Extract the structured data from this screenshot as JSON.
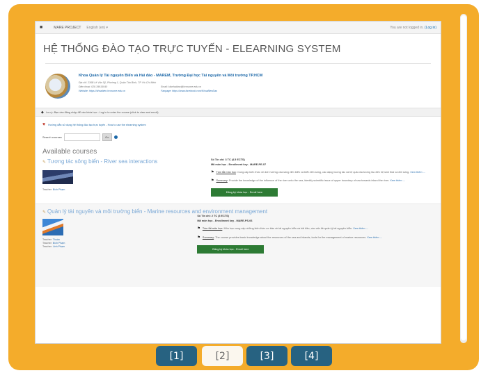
{
  "navbar": {
    "brand": "MARE PROJECT",
    "language": "English (en) ▾",
    "login_prefix": "You are not logged in.",
    "login_link": "(Log in)"
  },
  "site_title": "HỆ THỐNG ĐÀO TẠO TRỰC TUYẾN - ELEARNING SYSTEM",
  "faculty": {
    "name": "Khoa Quản lý Tài nguyên Biển và Hải đảo - MAREM, Trường Đại học Tài nguyên và Môi trường TP.HCM",
    "address": "Địa chỉ: 236B Lê Văn Sỹ, Phường 1, Quận Tân Bình, TP. Hồ Chí Minh",
    "phone": "Điện thoại: 028.39915040",
    "email": "Email: ktbnhaidao@hcmunre.edu.vn",
    "website": "Website: https://khoabien.hcmunre.edu.vn",
    "fanpage": "Fanpage: https://www.facebook.com/KhoaBienDao"
  },
  "notice": "Lưu ý: Bạn cần đăng nhập để vào khóa học - Log in to enter the course (click to view and enroll)",
  "guide_link": "Hướng dẫn sử dụng hệ thống đào tạo trực tuyến - How to use the elearning system",
  "search": {
    "label": "Search courses",
    "button": "Go"
  },
  "available_heading": "Available courses",
  "courses": [
    {
      "title": "Tương tác sông biển - River sea interactions",
      "teachers": [
        {
          "role": "Teacher:",
          "name": "Bích Phạm"
        }
      ],
      "credits": "Số Tín chỉ: 3 TC (4.5 ECTS)",
      "enrol_key": "Mã môn học - Enrollment key - MARE-PE-07",
      "desc_vi_label": "Tóm tắt môn học",
      "desc_vi": "Cung cấp kiến thức về ảnh hưởng của sông đến biển và biển đến sông, các dạng tương tác và hệ quả của tương tác đến hệ sinh thái và đời sống.",
      "desc_en_label": "Summary",
      "desc_en": "Provide the knowledge of the influence of the river onto the sea, identify scientific issue of upper boundary of sea towards inland the river.",
      "more": "Xem thêm ...",
      "enrol_button": "Đăng ký khóa học - Enroll here"
    },
    {
      "title": "Quản lý tài nguyên và môi trường biển - Marine resources and environment management",
      "teachers": [
        {
          "role": "Teacher:",
          "name": "Thuần"
        },
        {
          "role": "Teacher:",
          "name": "Bích Phạm"
        },
        {
          "role": "Teacher:",
          "name": "Linh Phạm"
        }
      ],
      "credits": "Số Tín chỉ: 2 TC (3 ECTS)",
      "enrol_key": "Mã môn học - Enrollment key - MARE-PS-06",
      "desc_vi_label": "Tóm tắt môn học",
      "desc_vi": "Môn học cung cấp những kiến thức cơ bản về tài nguyên biển và hải đảo, các vấn đề quản lý tài nguyên biển.",
      "desc_en_label": "Summary",
      "desc_en": "The course provides basic knowledge about the resources of the sea and islands, tools for the management of marine resources.",
      "more": "Xem thêm ...",
      "enrol_button": "Đăng ký khóa học - Enroll here"
    }
  ],
  "pager": {
    "pages": [
      "[1]",
      "[2]",
      "[3]",
      "[4]"
    ],
    "active_index": 1
  },
  "colors": {
    "frame": "#f4ac2b",
    "pager_button": "#276281",
    "pager_active": "#fbf7ee",
    "enroll_button": "#2d7b34",
    "link": "#1c68a8"
  }
}
